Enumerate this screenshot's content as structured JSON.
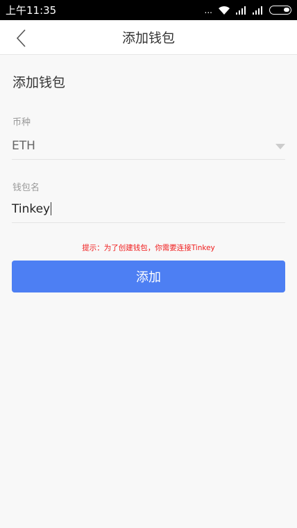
{
  "status": {
    "time": "上午11:35",
    "dots": "..."
  },
  "nav": {
    "title": "添加钱包"
  },
  "form": {
    "heading": "添加钱包",
    "currency_label": "币种",
    "currency_value": "ETH",
    "name_label": "钱包名",
    "name_value": "Tinkey",
    "hint": "提示：为了创建钱包，你需要连接Tinkey",
    "submit_label": "添加"
  },
  "colors": {
    "accent": "#4d7ff3",
    "hint": "#f01c1c"
  }
}
